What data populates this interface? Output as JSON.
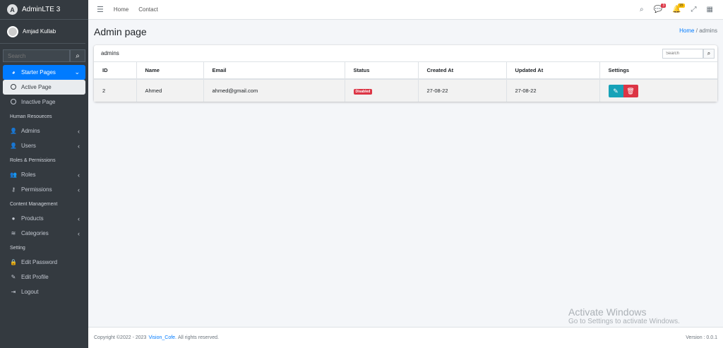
{
  "brand": "AdminLTE 3",
  "user": "Amjad Kullab",
  "sidebar_search_placeholder": "Search",
  "nav": {
    "starter": "Starter Pages",
    "active": "Active Page",
    "inactive": "Inactive Page",
    "h_hr": "Human Resoueces",
    "admins": "Admins",
    "users": "Users",
    "h_roles": "Roles & Permissions",
    "roles": "Roles",
    "permissions": "Permissions",
    "h_content": "Content Management",
    "products": "Products",
    "categories": "Categories",
    "h_setting": "Setting",
    "edit_password": "Edit Password",
    "edit_profile": "Edit Profile",
    "logout": "Logout"
  },
  "top": {
    "home": "Home",
    "contact": "Contact",
    "messages_badge": "3",
    "notifications_badge": "15"
  },
  "page_title": "Admin page",
  "breadcrumb": {
    "home": "Home",
    "current": "admins"
  },
  "card": {
    "title": "admins",
    "search_placeholder": "Search"
  },
  "table": {
    "headers": [
      "ID",
      "Name",
      "Email",
      "Status",
      "Created At",
      "Updated At",
      "Settings"
    ],
    "rows": [
      {
        "id": "2",
        "name": "Ahmed",
        "email": "ahmed@gmail.com",
        "status": "Disabled",
        "created": "27-08-22",
        "updated": "27-08-22"
      }
    ]
  },
  "footer": {
    "copyright": "Copyright ©2022 - 2023",
    "company": "Vision_Cofe.",
    "rights": "All rights reserved.",
    "version": "Version : 0.0.1"
  },
  "watermark": {
    "line1": "Activate Windows",
    "line2": "Go to Settings to activate Windows."
  },
  "colors": {
    "primary": "#007bff",
    "danger": "#dc3545",
    "info": "#17a2b8",
    "sidebar": "#343a40"
  }
}
